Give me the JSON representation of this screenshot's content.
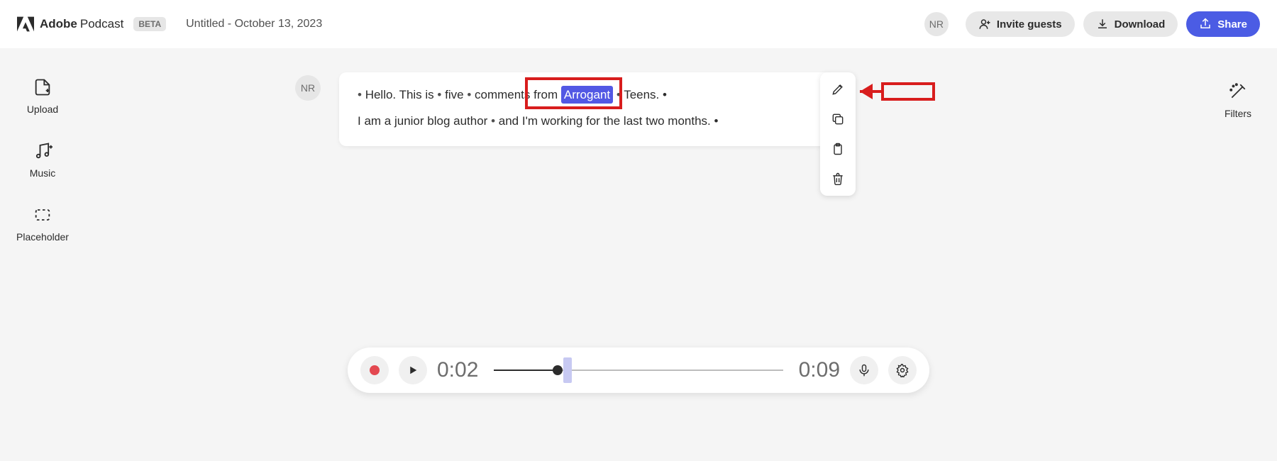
{
  "header": {
    "brand_bold": "Adobe",
    "brand_rest": "Podcast",
    "beta": "BETA",
    "doc_title": "Untitled - October 13, 2023",
    "avatar_initials": "NR",
    "invite_label": "Invite guests",
    "download_label": "Download",
    "share_label": "Share"
  },
  "left_rail": {
    "upload": "Upload",
    "music": "Music",
    "placeholder": "Placeholder"
  },
  "right_rail": {
    "filters": "Filters"
  },
  "speaker_initials": "NR",
  "transcript": {
    "line1_pre": "Hello.   This   is",
    "line1_mid1": "five",
    "line1_mid2": "comments   from",
    "line1_selected": "Arrogant",
    "line1_after_sel": "Teens.",
    "line2_a": "I   am   a   junior   blog   author",
    "line2_b": "and   I'm   working   for   the   last   two   months."
  },
  "playback": {
    "current": "0:02",
    "total": "0:09",
    "progress_pct": 22,
    "region_start_pct": 24,
    "region_width_pct": 3
  },
  "icons": {
    "upload": "upload-icon",
    "music": "music-icon",
    "placeholder": "placeholder-icon",
    "filters": "filters-icon",
    "edit": "pencil-icon",
    "copy": "copy-icon",
    "paste": "clipboard-icon",
    "delete": "trash-icon",
    "invite": "user-plus-icon",
    "download": "download-icon",
    "share": "share-icon",
    "record": "record-icon",
    "play": "play-icon",
    "mic": "mic-icon",
    "settings": "gear-icon"
  }
}
